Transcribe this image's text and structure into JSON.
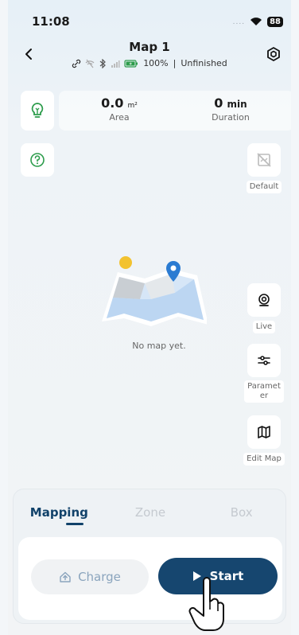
{
  "status_bar": {
    "time": "11:08",
    "signal_dots": "....",
    "battery": "88"
  },
  "header": {
    "title": "Map 1",
    "battery_percent": "100%",
    "separator": "|",
    "mapping_state": "Unfinished"
  },
  "stats": {
    "area": {
      "value": "0.0",
      "unit": "m²",
      "label": "Area"
    },
    "duration": {
      "value": "0",
      "unit": "min",
      "label": "Duration"
    }
  },
  "tools": {
    "default_label": "Default",
    "live_label": "Live",
    "parameter_label_line1": "Paramet",
    "parameter_label_line2": "er",
    "edit_map_label": "Edit Map"
  },
  "map": {
    "empty_text": "No map yet."
  },
  "tabs": {
    "items": [
      "Mapping",
      "Zone",
      "Box"
    ],
    "active": "Mapping"
  },
  "actions": {
    "charge_label": "Charge",
    "start_label": "Start"
  },
  "colors": {
    "primary": "#16466f",
    "accent_green": "#2c9c4b",
    "pin_blue": "#2a7bd2",
    "sun_yellow": "#f2c230"
  }
}
